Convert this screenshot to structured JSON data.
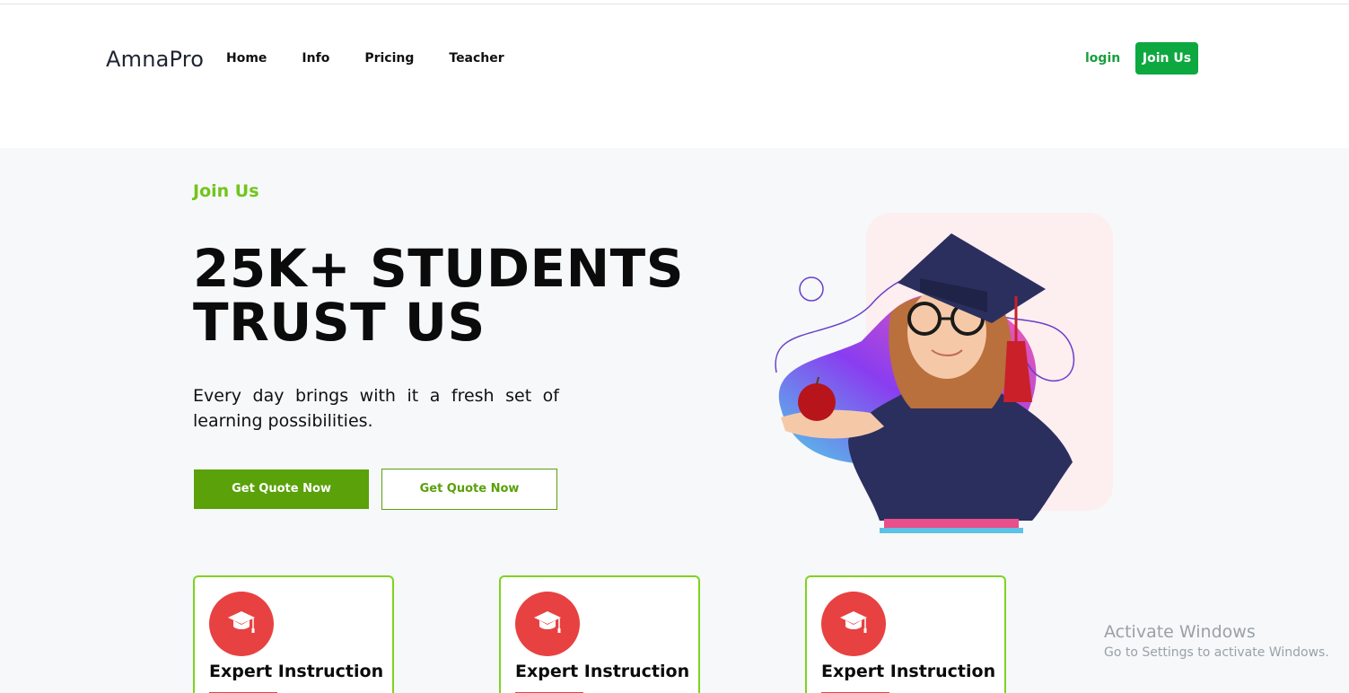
{
  "header": {
    "brand": "AmnaPro",
    "nav": [
      {
        "label": "Home"
      },
      {
        "label": "Info"
      },
      {
        "label": "Pricing"
      },
      {
        "label": "Teacher"
      }
    ],
    "login_label": "login",
    "join_label": "Join Us"
  },
  "hero": {
    "eyebrow": "Join Us",
    "headline_line1": "25K+ STUDENTS",
    "headline_line2": "TRUST US",
    "subtext": "Every day brings with it a fresh set of learning possibilities.",
    "primary_button": "Get Quote Now",
    "secondary_button": "Get Quote Now",
    "image_icon": "graduate-girl-illustration"
  },
  "features": [
    {
      "title": "Expert Instruction",
      "icon": "graduation-cap-icon"
    },
    {
      "title": "Expert Instruction",
      "icon": "graduation-cap-icon"
    },
    {
      "title": "Expert Instruction",
      "icon": "graduation-cap-icon"
    }
  ],
  "watermark": {
    "title": "Activate Windows",
    "subtitle": "Go to Settings to activate Windows."
  },
  "colors": {
    "accent_green": "#0ea841",
    "eyebrow_green": "#72c51a",
    "button_green": "#5aa10a",
    "card_border": "#7ed321",
    "icon_red": "#e84141",
    "hero_bg": "#f6f8fa"
  }
}
